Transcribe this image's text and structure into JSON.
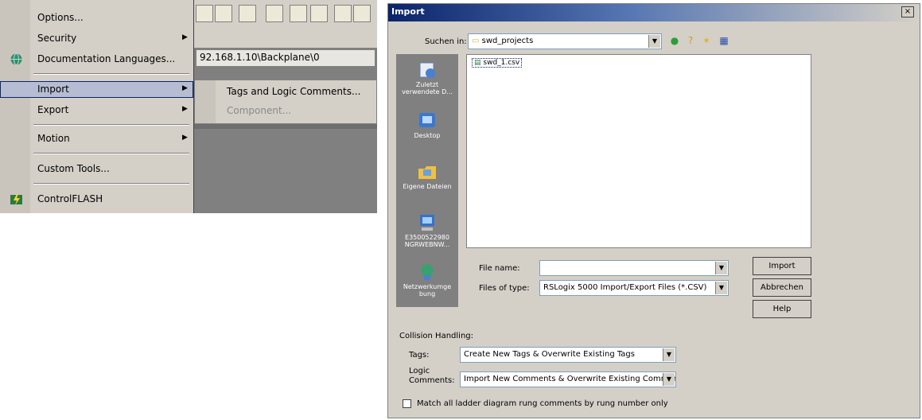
{
  "menu": {
    "items": [
      {
        "label": "Options...",
        "arrow": ""
      },
      {
        "label": "Security",
        "arrow": "▶"
      },
      {
        "label": "Documentation Languages...",
        "arrow": ""
      },
      {
        "label": "Import",
        "arrow": "▶"
      },
      {
        "label": "Export",
        "arrow": "▶"
      },
      {
        "label": "Motion",
        "arrow": "▶"
      },
      {
        "label": "Custom Tools...",
        "arrow": ""
      },
      {
        "label": "ControlFLASH",
        "arrow": ""
      }
    ],
    "path": "92.168.1.10\\Backplane\\0",
    "submenu": {
      "tags_and_logic": "Tags and Logic Comments...",
      "component": "Component..."
    }
  },
  "dialog": {
    "title": "Import",
    "close": "×",
    "look_in_label": "Suchen in:",
    "look_in_value": "swd_projects",
    "places": [
      "Zuletzt verwendete D...",
      "Desktop",
      "Eigene Dateien",
      "E3500522980 NGRWEBNW...",
      "Netzwerkumge bung"
    ],
    "file": "swd_1.csv",
    "file_name_label": "File name:",
    "file_name_value": "",
    "file_type_label": "Files of type:",
    "file_type_value": "RSLogix 5000 Import/Export Files (*.CSV)",
    "buttons": {
      "import": "Import",
      "cancel": "Abbrechen",
      "help": "Help"
    },
    "collision_label": "Collision Handling:",
    "tags_label": "Tags:",
    "tags_value": "Create New Tags & Overwrite Existing Tags",
    "logic_label": "Logic",
    "comments_label": "Comments:",
    "comments_value": "Import New Comments & Overwrite Existing Comments",
    "match_label": "Match all ladder diagram rung comments by rung number only",
    "match_checked": false
  },
  "colors": {
    "title_gradient_start": "#0a246a",
    "highlight": "#b6bdd2",
    "face": "#d4d0c8"
  }
}
